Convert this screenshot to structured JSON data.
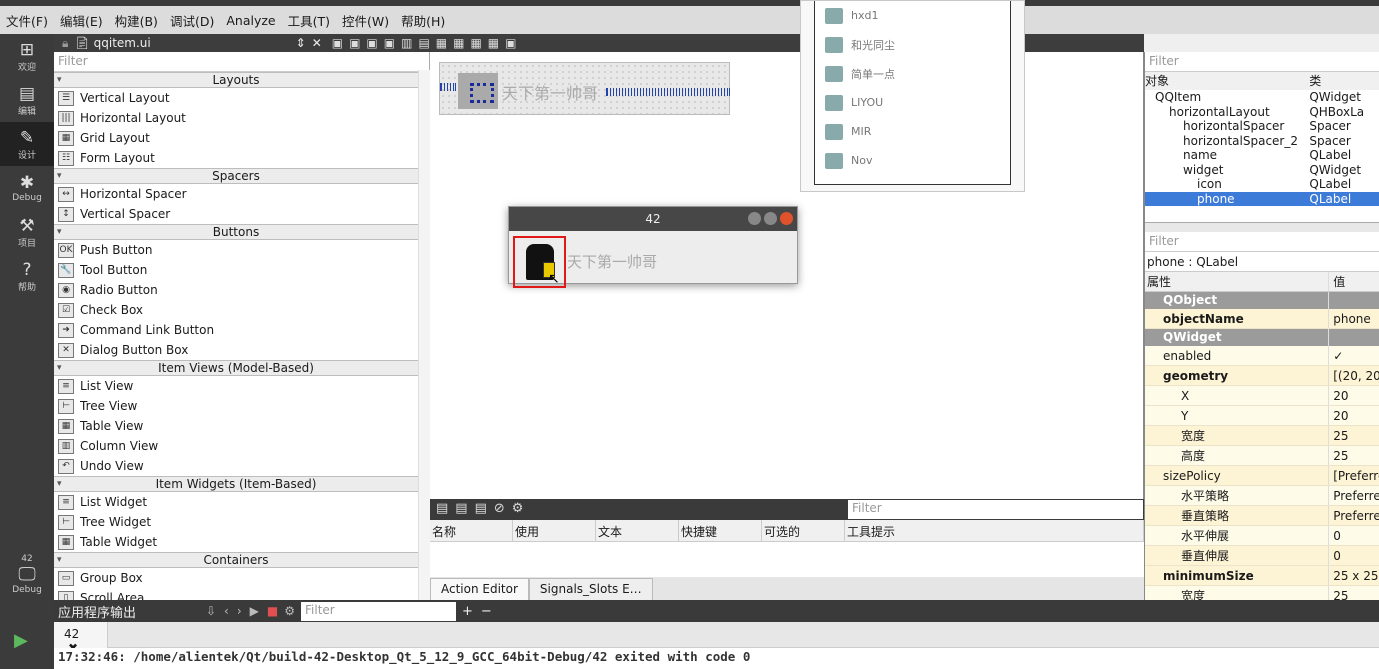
{
  "menu": [
    "文件(F)",
    "编辑(E)",
    "构建(B)",
    "调试(D)",
    "Analyze",
    "工具(T)",
    "控件(W)",
    "帮助(H)"
  ],
  "modes": [
    {
      "label": "欢迎",
      "icon": "grid-icon"
    },
    {
      "label": "编辑",
      "icon": "edit-icon"
    },
    {
      "label": "设计",
      "icon": "pencil-icon"
    },
    {
      "label": "Debug",
      "icon": "bug-icon"
    },
    {
      "label": "项目",
      "icon": "wrench-icon"
    },
    {
      "label": "帮助",
      "icon": "help-icon"
    }
  ],
  "kit": {
    "project": "42",
    "label": "Debug"
  },
  "document": {
    "filename": "qqitem.ui"
  },
  "widgetbox": {
    "filter_placeholder": "Filter",
    "sections": [
      {
        "title": "Layouts",
        "items": [
          "Vertical Layout",
          "Horizontal Layout",
          "Grid Layout",
          "Form Layout"
        ]
      },
      {
        "title": "Spacers",
        "items": [
          "Horizontal Spacer",
          "Vertical Spacer"
        ]
      },
      {
        "title": "Buttons",
        "items": [
          "Push Button",
          "Tool Button",
          "Radio Button",
          "Check Box",
          "Command Link Button",
          "Dialog Button Box"
        ]
      },
      {
        "title": "Item Views (Model-Based)",
        "items": [
          "List View",
          "Tree View",
          "Table View",
          "Column View",
          "Undo View"
        ]
      },
      {
        "title": "Item Widgets (Item-Based)",
        "items": [
          "List Widget",
          "Tree Widget",
          "Table Widget"
        ]
      },
      {
        "title": "Containers",
        "items": [
          "Group Box",
          "Scroll Area"
        ]
      }
    ]
  },
  "form": {
    "name_text": "天下第一帅哥"
  },
  "popup_list": [
    "hxd1",
    "和光同尘",
    "简单一点",
    "LIYOU",
    "MIR",
    "Nov"
  ],
  "preview_window": {
    "title": "42",
    "name_text": "天下第一帅哥"
  },
  "action_editor": {
    "filter_placeholder": "Filter",
    "columns": [
      "名称",
      "使用",
      "文本",
      "快捷键",
      "可选的",
      "工具提示"
    ],
    "tabs": [
      "Action Editor",
      "Signals_Slots E…"
    ]
  },
  "object_inspector": {
    "filter_placeholder": "Filter",
    "headers": [
      "对象",
      "类"
    ],
    "rows": [
      {
        "name": "QQItem",
        "cls": "QWidget",
        "indent": 1
      },
      {
        "name": "horizontalLayout",
        "cls": "QHBoxLa",
        "indent": 2
      },
      {
        "name": "horizontalSpacer",
        "cls": "Spacer",
        "indent": 3
      },
      {
        "name": "horizontalSpacer_2",
        "cls": "Spacer",
        "indent": 3
      },
      {
        "name": "name",
        "cls": "QLabel",
        "indent": 3
      },
      {
        "name": "widget",
        "cls": "QWidget",
        "indent": 3
      },
      {
        "name": "icon",
        "cls": "QLabel",
        "indent": 4
      },
      {
        "name": "phone",
        "cls": "QLabel",
        "indent": 4
      }
    ],
    "selected": "phone"
  },
  "property_editor": {
    "filter_placeholder": "Filter",
    "caption": "phone : QLabel",
    "headers": [
      "属性",
      "值"
    ],
    "rows": [
      {
        "k": "QObject",
        "v": "",
        "t": "grp"
      },
      {
        "k": "objectName",
        "v": "phone",
        "t": "y1 b"
      },
      {
        "k": "QWidget",
        "v": "",
        "t": "grp"
      },
      {
        "k": "enabled",
        "v": "✓",
        "t": "y2"
      },
      {
        "k": "geometry",
        "v": "[(20, 20),",
        "t": "y1 b"
      },
      {
        "k": "X",
        "v": "20",
        "t": "y2 sub"
      },
      {
        "k": "Y",
        "v": "20",
        "t": "y2 sub"
      },
      {
        "k": "宽度",
        "v": "25",
        "t": "y1 sub"
      },
      {
        "k": "高度",
        "v": "25",
        "t": "y2 sub"
      },
      {
        "k": "sizePolicy",
        "v": "[Preferre",
        "t": "y1"
      },
      {
        "k": "水平策略",
        "v": "Preferre",
        "t": "y2 sub"
      },
      {
        "k": "垂直策略",
        "v": "Preferre",
        "t": "y1 sub"
      },
      {
        "k": "水平伸展",
        "v": "0",
        "t": "y2 sub"
      },
      {
        "k": "垂直伸展",
        "v": "0",
        "t": "y1 sub"
      },
      {
        "k": "minimumSize",
        "v": "25 x 25",
        "t": "y1 b"
      },
      {
        "k": "宽度",
        "v": "25",
        "t": "y2 sub"
      }
    ]
  },
  "output": {
    "title": "应用程序输出",
    "filter_placeholder": "Filter",
    "tab": "42",
    "text": "17:32:46: /home/alientek/Qt/build-42-Desktop_Qt_5_12_9_GCC_64bit-Debug/42 exited with code 0"
  }
}
